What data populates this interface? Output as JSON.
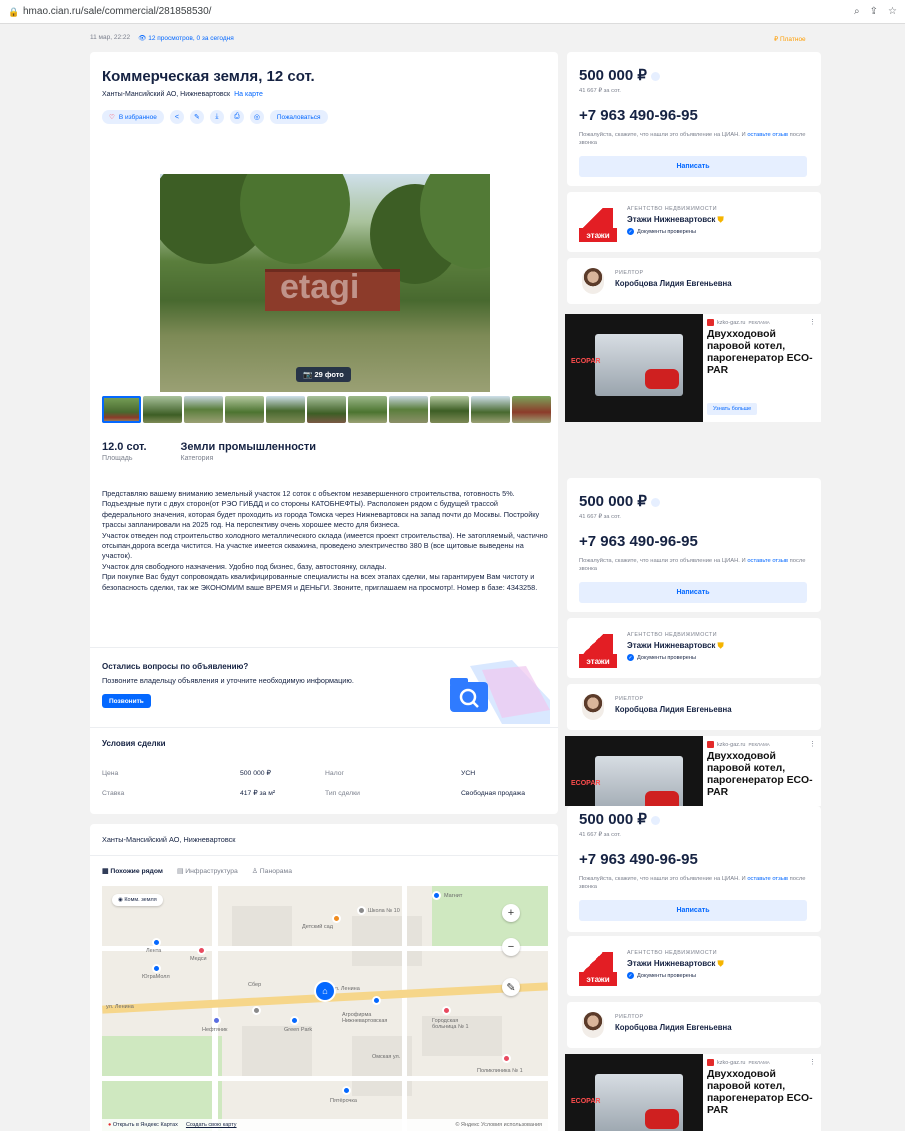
{
  "browser": {
    "url": "hmao.cian.ru/sale/commercial/281858530/",
    "lock_icon": "lock-icon"
  },
  "meta": {
    "date": "11 мар, 22:22",
    "views": "12 просмотров, 0 за сегодня",
    "paid": "₽ Платное"
  },
  "listing": {
    "title": "Коммерческая земля, 12 сот.",
    "address": "Ханты-Мансийский АО, Нижневартовск",
    "on_map": "На карте",
    "favorite": "В избранное",
    "complain": "Пожаловаться",
    "photo_count": "29 фото",
    "watermark": "etagi",
    "area_value": "12.0 сот.",
    "area_label": "Площадь",
    "category_value": "Земли промышленности",
    "category_label": "Категория",
    "description": [
      "Представляю вашему вниманию земельный участок 12 соток с объектом незавершенного строительства, готовность 5%. Подъездные пути с двух сторон(от РЭО ГИБДД и со стороны КАТОБНЕФТЫ). Расположен рядом с будущей трассой федерального значения, которая будет проходить из города Томска через Нижневартовск на запад почти до Москвы. Постройку трассы запланировали на 2025 год. На перспективу очень хорошее место для бизнеса.",
      "Участок отведен под строительство холодного металлического склада (имеется проект строительства). Не затопляемый, частично отсыпан,дорога всегда чистится. На участке имеется скважина, проведено электричество 380 В (все щитовые выведены на участок).",
      "Участок для свободного назначения. Удобно под бизнес, базу, автостоянку, склады.",
      "При покупке Вас будут сопровождать квалифицированные специалисты на всех этапах сделки, мы гарантируем Вам чистоту и безопасность сделки, так же ЭКОНОМИМ ваше ВРЕМЯ и ДЕНЬГИ. Звоните, приглашаем на просмотр!. Номер в базе: 4343258."
    ]
  },
  "questions": {
    "title": "Остались вопросы по объявлению?",
    "text": "Позвоните владельцу объявления и уточните необходимую информацию.",
    "button": "Позвонить"
  },
  "conditions": {
    "title": "Условия сделки",
    "rows": [
      [
        "Цена",
        "500 000 ₽",
        "Налог",
        "УСН"
      ],
      [
        "Ставка",
        "417 ₽ за м²",
        "Тип сделки",
        "Свободная продажа"
      ]
    ]
  },
  "map": {
    "address": "Ханты-Мансийский АО, Нижневартовск",
    "tabs": [
      "Похожие рядом",
      "Инфраструктура",
      "Панорама"
    ],
    "chip": "Комм. земля",
    "labels": [
      "ул. Ленина",
      "ул. Ленина",
      "Лента",
      "Медси",
      "Сбер",
      "Школа № 10",
      "Магнит",
      "Green Park",
      "Нефтяник",
      "Агрофирма Нижневартовская",
      "Городская больница № 1",
      "Омская ул.",
      "Поликлиника № 1",
      "Детский сад",
      "Пятёрочка",
      "ЮграМолл"
    ],
    "open_yandex": "Открыть в Яндекс Картах",
    "create_map": "Создать свою карту",
    "yandex_terms": "© Яндекс Условия использования"
  },
  "sidebar": {
    "price": "500 000 ₽",
    "per_unit": "41 667 ₽ за сот.",
    "phone": "+7 963 490-96-95",
    "hint": "Пожалуйста, скажите, что нашли это объявление на ЦИАН. И",
    "hint_link": "оставьте отзыв",
    "hint_tail": "после звонка",
    "write": "Написать",
    "agency_kind": "АГЕНТСТВО НЕДВИЖИМОСТИ",
    "agency_name": "Этажи Нижневартовск",
    "agency_logo": "этажи",
    "docs": "Документы проверены",
    "realtor_kind": "РИЕЛТОР",
    "realtor_name": "Коробцова Лидия Евгеньевна"
  },
  "ad": {
    "source": "kzko-gaz.ru",
    "tag": "РЕКЛАМА",
    "title": "Двухходовой паровой котел, парогенератор ECO-PAR",
    "brand": "ECOPAR",
    "button": "Узнать больше"
  },
  "colors": {
    "accent": "#0468ff",
    "text": "#152242",
    "muted": "#7a7f8c",
    "agency_red": "#e31e24"
  }
}
